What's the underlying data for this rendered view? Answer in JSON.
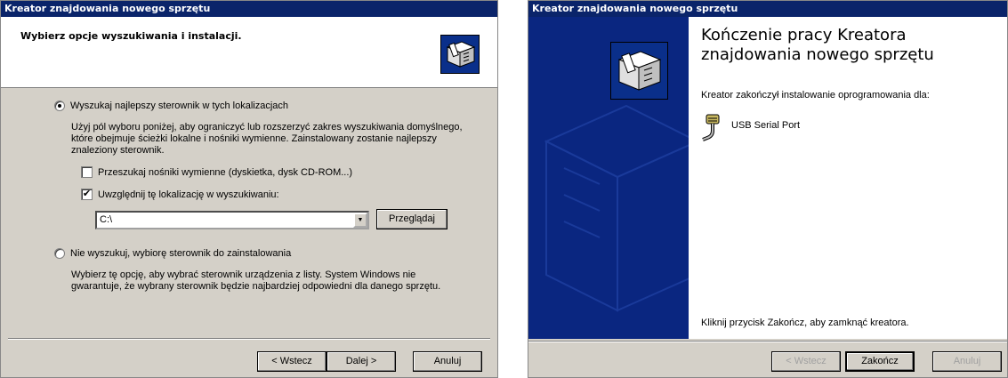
{
  "wizard1": {
    "title": "Kreator znajdowania nowego sprzętu",
    "header_title": "Wybierz opcje wyszukiwania i instalacji.",
    "option_search_label": "Wyszukaj najlepszy sterownik w tych lokalizacjach",
    "option_search_desc_1": "Użyj pól wyboru poniżej, aby ograniczyć lub rozszerzyć zakres wyszukiwania domyślnego,",
    "option_search_desc_2": "które obejmuje ścieżki lokalne i nośniki wymienne. Zainstalowany zostanie najlepszy",
    "option_search_desc_3": "znaleziony sterownik.",
    "check_removable_label": "Przeszukaj nośniki wymienne (dyskietka, dysk CD-ROM...)",
    "check_removable_checked": false,
    "check_location_label": "Uwzględnij tę lokalizację w wyszukiwaniu:",
    "check_location_checked": true,
    "location_value": "C:\\",
    "browse_label": "Przeglądaj",
    "option_manual_label": "Nie wyszukuj, wybiorę sterownik do zainstalowania",
    "option_manual_desc_1": "Wybierz tę opcję, aby wybrać sterownik urządzenia z listy. System Windows nie",
    "option_manual_desc_2": "gwarantuje, że wybrany sterownik będzie najbardziej odpowiedni dla danego sprzętu.",
    "back_label": "< Wstecz",
    "next_label": "Dalej >",
    "cancel_label": "Anuluj"
  },
  "wizard2": {
    "title": "Kreator znajdowania nowego sprzętu",
    "big_title_1": "Kończenie pracy Kreatora",
    "big_title_2": "znajdowania nowego sprzętu",
    "finished_text": "Kreator zakończył instalowanie oprogramowania dla:",
    "device_name": "USB Serial Port",
    "close_hint": "Kliknij przycisk Zakończ, aby zamknąć kreatora.",
    "back_label": "< Wstecz",
    "finish_label": "Zakończ",
    "cancel_label": "Anuluj"
  },
  "colors": {
    "titlebar": "#0a246a",
    "dialog_face": "#d4d0c8",
    "sidebar_blue": "#0a2680"
  }
}
